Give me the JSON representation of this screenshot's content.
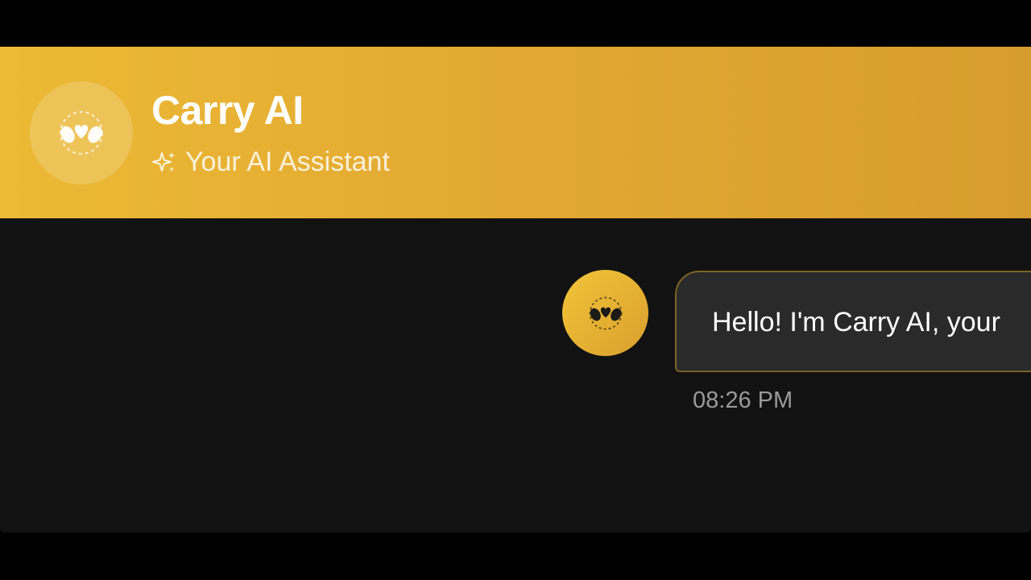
{
  "header": {
    "title": "Carry AI",
    "subtitle": "Your AI Assistant",
    "avatar_icon": "hands-heart-icon",
    "subtitle_icon": "sparkles-icon"
  },
  "messages": [
    {
      "sender": "bot",
      "avatar_icon": "hands-heart-icon",
      "text": "Hello! I'm Carry AI, your",
      "time": "08:26 PM"
    }
  ],
  "colors": {
    "accent": "#e2a832",
    "background": "#121212",
    "bubble": "#2a2a2a",
    "bubble_border": "#7c6326"
  }
}
